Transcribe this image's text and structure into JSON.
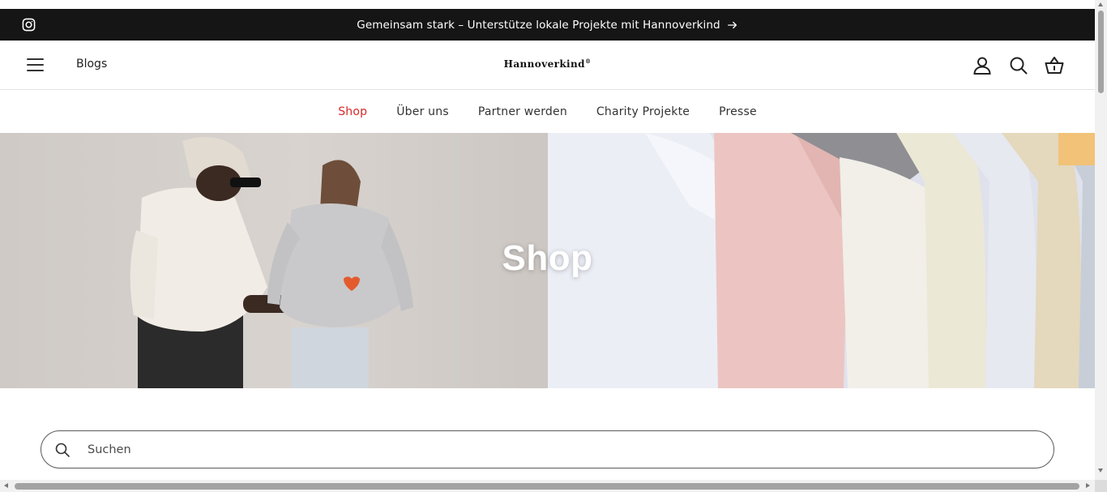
{
  "announcement": {
    "text": "Gemeinsam stark – Unterstütze lokale Projekte mit Hannoverkind",
    "icon": "instagram-icon",
    "arrow_icon": "arrow-right-icon",
    "background": "#151515"
  },
  "header": {
    "menu_icon": "hamburger-icon",
    "blogs_label": "Blogs",
    "logo_text": "Hannoverkind",
    "logo_mark": "®",
    "icons": [
      "account-icon",
      "search-icon",
      "basket-icon"
    ]
  },
  "nav": {
    "items": [
      {
        "label": "Shop",
        "active": true
      },
      {
        "label": "Über uns",
        "active": false
      },
      {
        "label": "Partner werden",
        "active": false
      },
      {
        "label": "Charity Projekte",
        "active": false
      },
      {
        "label": "Presse",
        "active": false
      }
    ],
    "active_color": "#d62828"
  },
  "hero": {
    "title": "Shop"
  },
  "search": {
    "placeholder": "Suchen",
    "value": ""
  }
}
